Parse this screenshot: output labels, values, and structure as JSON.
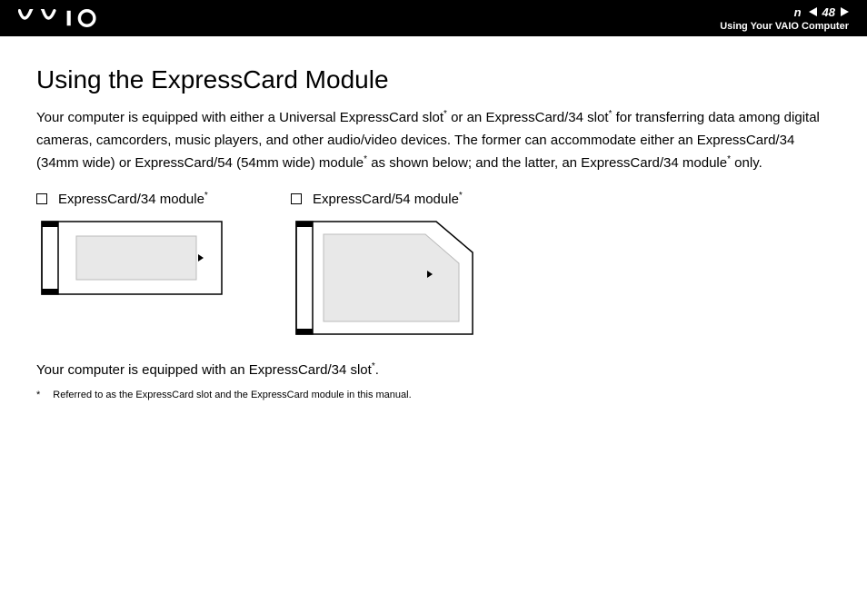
{
  "header": {
    "page_number": "48",
    "section": "Using Your VAIO Computer",
    "n_text": "n"
  },
  "content": {
    "heading": "Using the ExpressCard Module",
    "para1_part1": "Your computer is equipped with either a Universal ExpressCard slot",
    "para1_part2": " or an ExpressCard/34 slot",
    "para1_part3": " for transferring data among digital cameras, camcorders, music players, and other audio/video devices. The former can accommodate either an ExpressCard/34 (34mm wide) or ExpressCard/54 (54mm wide) module",
    "para1_part4": " as shown below; and the latter, an ExpressCard/34 module",
    "para1_part5": " only.",
    "module34_label": "ExpressCard/34 module",
    "module54_label": "ExpressCard/54 module",
    "para2_part1": "Your computer is equipped with an ExpressCard/34 slot",
    "para2_part2": ".",
    "footnote_mark": "*",
    "footnote_text": "Referred to as the ExpressCard slot and the ExpressCard module in this manual.",
    "asterisk": "*"
  }
}
